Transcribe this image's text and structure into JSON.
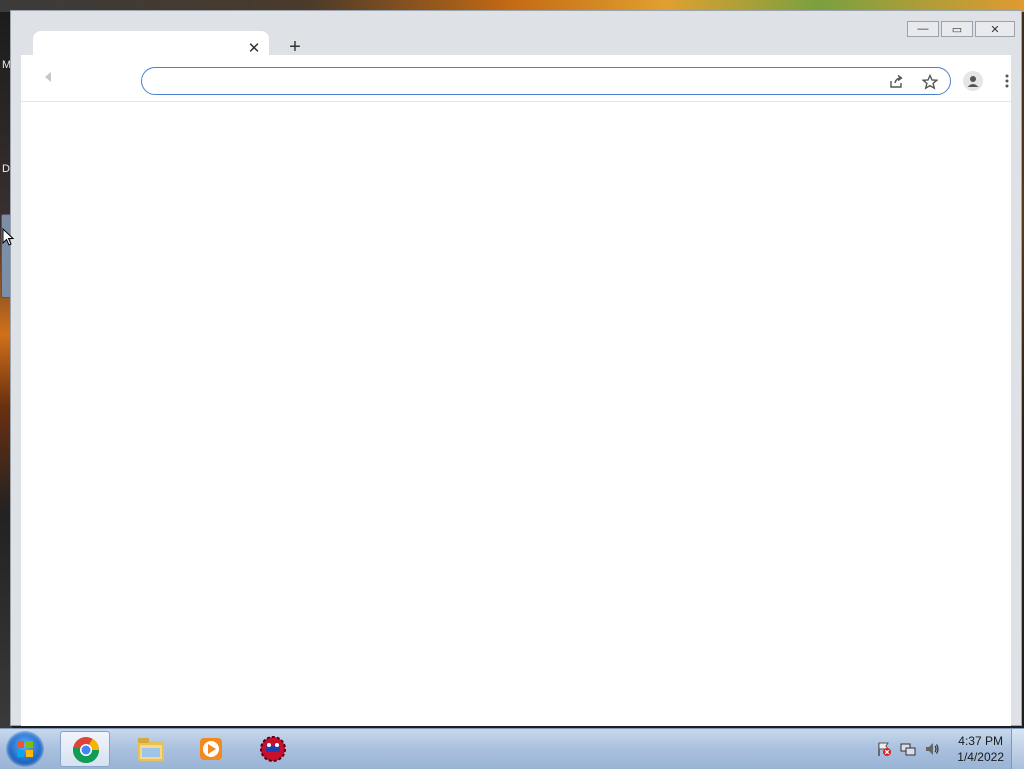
{
  "desktop": {
    "side_labels": [
      "M",
      "D"
    ]
  },
  "browser": {
    "tab": {
      "title": "",
      "close_glyph": "✕"
    },
    "new_tab_glyph": "+",
    "omnibox": {
      "value": "",
      "placeholder": ""
    },
    "icons": {
      "back": "back-arrow-icon",
      "share": "share-icon",
      "bookmark": "star-icon",
      "profile": "profile-icon",
      "menu": "kebab-menu-icon"
    },
    "window_controls": {
      "minimize": "—",
      "maximize": "▭",
      "close": "✕"
    }
  },
  "taskbar": {
    "apps": [
      {
        "name": "Google Chrome",
        "icon": "chrome-icon",
        "active": true
      },
      {
        "name": "Windows Explorer",
        "icon": "folder-icon",
        "active": false
      },
      {
        "name": "Windows Media Player",
        "icon": "media-player-icon",
        "active": false
      },
      {
        "name": "Game",
        "icon": "red-ball-icon",
        "active": false
      }
    ],
    "tray": [
      "flag-alert-icon",
      "network-icon",
      "volume-icon"
    ],
    "clock": {
      "time": "4:37 PM",
      "date": "1/4/2022"
    }
  }
}
